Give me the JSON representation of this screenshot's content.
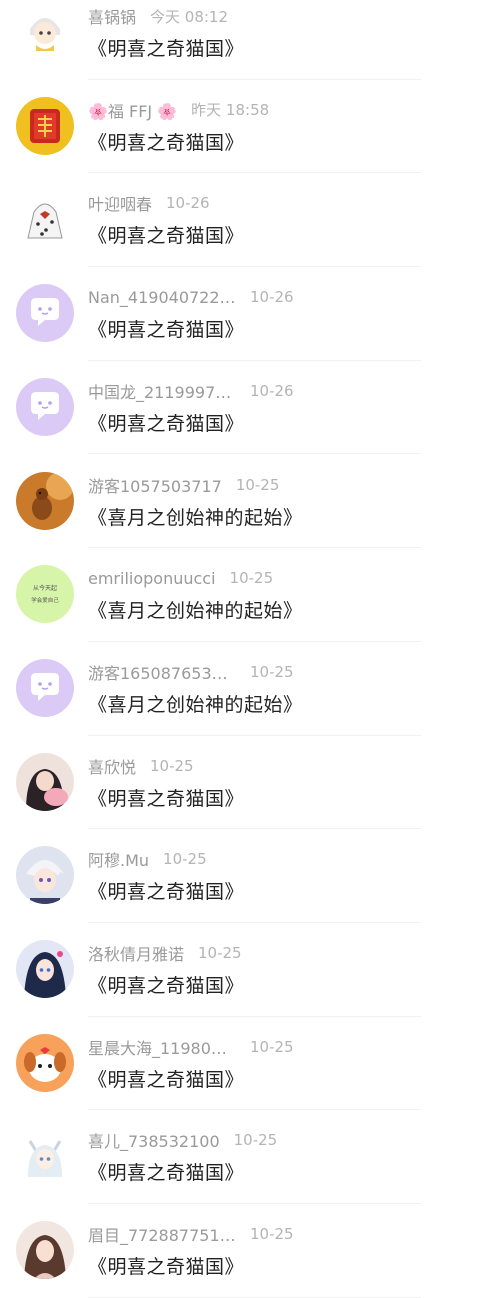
{
  "comments": [
    {
      "name": "喜锅锅",
      "time": "今天 08:12",
      "text": "《明喜之奇猫国》",
      "avatar": "chibi-character-icon"
    },
    {
      "name": "🌸福 FFJ 🌸",
      "time": "昨天 18:58",
      "text": "《明喜之奇猫国》",
      "avatar": "fortune-charm-icon"
    },
    {
      "name": "叶迎咽春",
      "time": "10-26",
      "text": "《明喜之奇猫国》",
      "avatar": "dotted-figure-icon"
    },
    {
      "name": "Nan_419040722…",
      "time": "10-26",
      "text": "《明喜之奇猫国》",
      "avatar": "default-chat-bubble-icon"
    },
    {
      "name": "中国龙_2119997…",
      "time": "10-26",
      "text": "《明喜之奇猫国》",
      "avatar": "default-chat-bubble-icon"
    },
    {
      "name": "游客1057503717",
      "time": "10-25",
      "text": "《喜月之创始神的起始》",
      "avatar": "squirrel-photo-icon"
    },
    {
      "name": "emrilioponuucci",
      "time": "10-25",
      "text": "《喜月之创始神的起始》",
      "avatar": "text-badge-icon",
      "avatar_lines": [
        "从今天起",
        "学会爱自己"
      ]
    },
    {
      "name": "游客165087653…",
      "time": "10-25",
      "text": "《喜月之创始神的起始》",
      "avatar": "default-chat-bubble-icon"
    },
    {
      "name": "喜欣悦",
      "time": "10-25",
      "text": "《明喜之奇猫国》",
      "avatar": "girl-photo-icon"
    },
    {
      "name": "阿穆.Mu",
      "time": "10-25",
      "text": "《明喜之奇猫国》",
      "avatar": "anime-boy-icon"
    },
    {
      "name": "洛秋倩月雅诺",
      "time": "10-25",
      "text": "《明喜之奇猫国》",
      "avatar": "anime-girl-icon"
    },
    {
      "name": "星晨大海_11980…",
      "time": "10-25",
      "text": "《明喜之奇猫国》",
      "avatar": "cartoon-dog-icon"
    },
    {
      "name": "喜儿_738532100",
      "time": "10-25",
      "text": "《明喜之奇猫国》",
      "avatar": "anime-cat-girl-icon"
    },
    {
      "name": "眉目_772887751…",
      "time": "10-25",
      "text": "《明喜之奇猫国》",
      "avatar": "portrait-photo-icon"
    }
  ],
  "colors": {
    "name": "#9a9a9a",
    "time": "#b4b4b4",
    "text": "#222222",
    "default_avatar": "#d9c8f5",
    "default_bubble": "#ffffff"
  }
}
